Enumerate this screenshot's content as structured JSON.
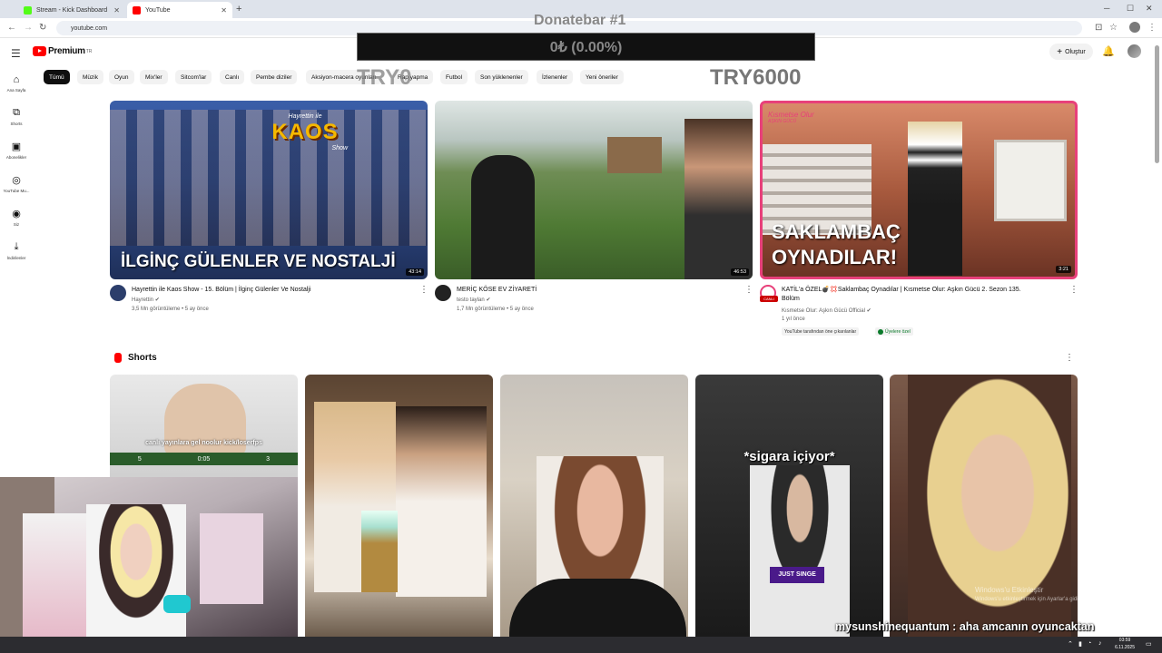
{
  "browser": {
    "tabs": [
      {
        "title": "Stream - Kick Dashboard",
        "favicon_color": "#53fc18"
      },
      {
        "title": "YouTube",
        "favicon_color": "#ff0000"
      }
    ],
    "url": "youtube.com"
  },
  "header": {
    "logo_text": "Premium",
    "logo_sup": "TR",
    "create_label": "Oluştur"
  },
  "sidebar": [
    {
      "label": "Ana Sayfa",
      "icon": "home-icon"
    },
    {
      "label": "Shorts",
      "icon": "shorts-icon"
    },
    {
      "label": "Abonelikler",
      "icon": "subscriptions-icon"
    },
    {
      "label": "YouTube Mu...",
      "icon": "youtube-music-icon"
    },
    {
      "label": "Siz",
      "icon": "you-icon"
    },
    {
      "label": "İndirilenler",
      "icon": "download-icon"
    }
  ],
  "chips": [
    "Tümü",
    "Müzik",
    "Oyun",
    "Mix'ler",
    "Sitcom'lar",
    "Canlı",
    "Pembe diziler",
    "Aksiyon-macera oyunları",
    "Rap yapma",
    "Futbol",
    "Son yüklenenler",
    "İzlenenler",
    "Yeni öneriler"
  ],
  "donatebar": {
    "title": "Donatebar #1",
    "value": "0₺ (0.00%)",
    "progress_percent": 0,
    "min_label": "TRY0",
    "max_label": "TRY6000"
  },
  "videos": [
    {
      "title": "Hayrettin ile Kaos Show - 15. Bölüm | İlginç Gülenler Ve Nostalji",
      "channel": "Hayrettin",
      "stats": "3,5 Mn görüntüleme • 5 ay önce",
      "duration": "43:14",
      "thumb_text": "İLGİNÇ GÜLENLER VE NOSTALJİ",
      "thumb_logo": "KAOS",
      "thumb_logo_small": "Hayrettin ile",
      "thumb_logo_sub": "Show"
    },
    {
      "title": "MERİÇ KÖSE EV ZİYARETİ",
      "channel": "testo taylan",
      "stats": "1,7 Mn görüntüleme • 5 ay önce",
      "duration": "46:53"
    },
    {
      "title_line1": "KATİL'a ÖZEL💣💢Saklambaç Oynadılar | Kısmetse Olur: Aşkın Gücü 2. Sezon 135.",
      "title_line2": "Bölüm",
      "channel": "Kısmetse Olur: Aşkın Gücü Official",
      "stats": "1 yıl önce",
      "duration": "3:21",
      "thumb_text_1": "SAKLAMBAÇ",
      "thumb_text_2": "OYNADILAR!",
      "thumb_brand": "Kısmetse Olur",
      "thumb_brand_sub": "AŞKIN GÜCÜ",
      "live_badge": "CANLI",
      "badges": [
        "YouTube tarafından öne çıkarılanlar",
        "Üyelere özel"
      ]
    }
  ],
  "shorts": {
    "title": "Shorts",
    "items": [
      {
        "caption": "canlı yayınlara gel noolur kick/loserfps",
        "score_left": "5",
        "score_mid": "0:05",
        "score_right": "3"
      },
      {
        "caption": ""
      },
      {
        "caption": ""
      },
      {
        "caption": "*sigara içiyor*",
        "caption2": "JUST SINGE"
      },
      {
        "caption": ""
      }
    ]
  },
  "chat": {
    "message": "mysunshinequantum : aha amcanın oyuncaktan"
  },
  "windows": {
    "watermark_1": "Windows'u Etkinleştir",
    "watermark_2": "Windows'u etkinleştirmek için Ayarlar'a gidin.",
    "time": "03:59",
    "date": "6.11.2025"
  }
}
